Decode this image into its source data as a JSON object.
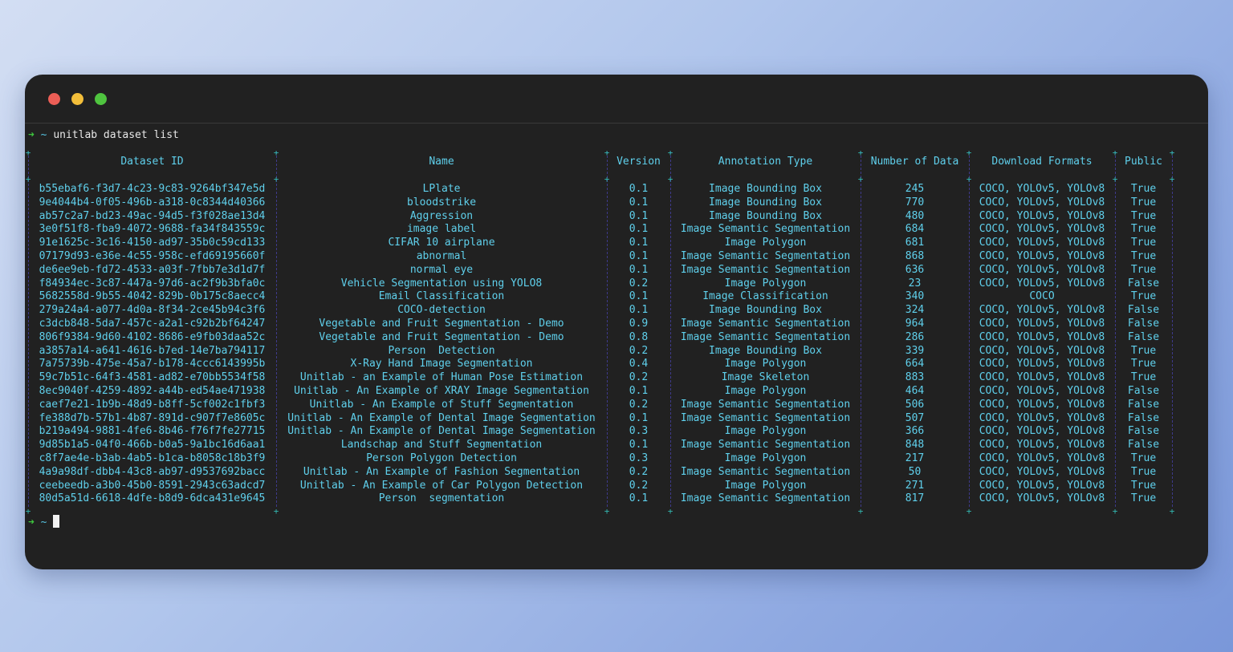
{
  "window": {
    "traffic_lights": [
      "close",
      "minimize",
      "zoom"
    ]
  },
  "prompt": {
    "arrow": "➜",
    "tilde": "~",
    "command": "unitlab dataset list"
  },
  "table": {
    "columns": [
      "Dataset ID",
      "Name",
      "Version",
      "Annotation Type",
      "Number of Data",
      "Download Formats",
      "Public"
    ],
    "rows": [
      [
        "b55ebaf6-f3d7-4c23-9c83-9264bf347e5d",
        "LPlate",
        "0.1",
        "Image Bounding Box",
        "245",
        "COCO, YOLOv5, YOLOv8",
        "True"
      ],
      [
        "9e4044b4-0f05-496b-a318-0c8344d40366",
        "bloodstrike",
        "0.1",
        "Image Bounding Box",
        "770",
        "COCO, YOLOv5, YOLOv8",
        "True"
      ],
      [
        "ab57c2a7-bd23-49ac-94d5-f3f028ae13d4",
        "Aggression",
        "0.1",
        "Image Bounding Box",
        "480",
        "COCO, YOLOv5, YOLOv8",
        "True"
      ],
      [
        "3e0f51f8-fba9-4072-9688-fa34f843559c",
        "image label",
        "0.1",
        "Image Semantic Segmentation",
        "684",
        "COCO, YOLOv5, YOLOv8",
        "True"
      ],
      [
        "91e1625c-3c16-4150-ad97-35b0c59cd133",
        "CIFAR 10 airplane",
        "0.1",
        "Image Polygon",
        "681",
        "COCO, YOLOv5, YOLOv8",
        "True"
      ],
      [
        "07179d93-e36e-4c55-958c-efd69195660f",
        "abnormal",
        "0.1",
        "Image Semantic Segmentation",
        "868",
        "COCO, YOLOv5, YOLOv8",
        "True"
      ],
      [
        "de6ee9eb-fd72-4533-a03f-7fbb7e3d1d7f",
        "normal eye",
        "0.1",
        "Image Semantic Segmentation",
        "636",
        "COCO, YOLOv5, YOLOv8",
        "True"
      ],
      [
        "f84934ec-3c87-447a-97d6-ac2f9b3bfa0c",
        "Vehicle Segmentation using YOLO8",
        "0.2",
        "Image Polygon",
        "23",
        "COCO, YOLOv5, YOLOv8",
        "False"
      ],
      [
        "5682558d-9b55-4042-829b-0b175c8aecc4",
        "Email Classification",
        "0.1",
        "Image Classification",
        "340",
        "COCO",
        "True"
      ],
      [
        "279a24a4-a077-4d0a-8f34-2ce45b94c3f6",
        "COCO-detection",
        "0.1",
        "Image Bounding Box",
        "324",
        "COCO, YOLOv5, YOLOv8",
        "False"
      ],
      [
        "c3dcb848-5da7-457c-a2a1-c92b2bf64247",
        "Vegetable and Fruit Segmentation - Demo",
        "0.9",
        "Image Semantic Segmentation",
        "964",
        "COCO, YOLOv5, YOLOv8",
        "False"
      ],
      [
        "806f9384-9d60-4102-8686-e9fb03daa52c",
        "Vegetable and Fruit Segmentation - Demo",
        "0.8",
        "Image Semantic Segmentation",
        "286",
        "COCO, YOLOv5, YOLOv8",
        "False"
      ],
      [
        "a3857a14-a641-4616-b7ed-14e7ba794117",
        "Person  Detection",
        "0.2",
        "Image Bounding Box",
        "339",
        "COCO, YOLOv5, YOLOv8",
        "True"
      ],
      [
        "7a75739b-475e-45a7-b178-4ccc6143995b",
        "X-Ray Hand Image Segmentation",
        "0.4",
        "Image Polygon",
        "664",
        "COCO, YOLOv5, YOLOv8",
        "True"
      ],
      [
        "59c7b51c-64f3-4581-ad82-e70bb5534f58",
        "Unitlab - an Example of Human Pose Estimation",
        "0.2",
        "Image Skeleton",
        "883",
        "COCO, YOLOv5, YOLOv8",
        "True"
      ],
      [
        "8ec9040f-4259-4892-a44b-ed54ae471938",
        "Unitlab - An Example of XRAY Image Segmentation",
        "0.1",
        "Image Polygon",
        "464",
        "COCO, YOLOv5, YOLOv8",
        "False"
      ],
      [
        "caef7e21-1b9b-48d9-b8ff-5cf002c1fbf3",
        "Unitlab - An Example of Stuff Segmentation",
        "0.2",
        "Image Semantic Segmentation",
        "506",
        "COCO, YOLOv5, YOLOv8",
        "False"
      ],
      [
        "fe388d7b-57b1-4b87-891d-c907f7e8605c",
        "Unitlab - An Example of Dental Image Segmentation",
        "0.1",
        "Image Semantic Segmentation",
        "507",
        "COCO, YOLOv5, YOLOv8",
        "False"
      ],
      [
        "b219a494-9881-4fe6-8b46-f76f7fe27715",
        "Unitlab - An Example of Dental Image Segmentation",
        "0.3",
        "Image Polygon",
        "366",
        "COCO, YOLOv5, YOLOv8",
        "False"
      ],
      [
        "9d85b1a5-04f0-466b-b0a5-9a1bc16d6aa1",
        "Landschap and Stuff Segmentation",
        "0.1",
        "Image Semantic Segmentation",
        "848",
        "COCO, YOLOv5, YOLOv8",
        "False"
      ],
      [
        "c8f7ae4e-b3ab-4ab5-b1ca-b8058c18b3f9",
        "Person Polygon Detection",
        "0.3",
        "Image Polygon",
        "217",
        "COCO, YOLOv5, YOLOv8",
        "True"
      ],
      [
        "4a9a98df-dbb4-43c8-ab97-d9537692bacc",
        "Unitlab - An Example of Fashion Segmentation",
        "0.2",
        "Image Semantic Segmentation",
        "50",
        "COCO, YOLOv5, YOLOv8",
        "True"
      ],
      [
        "ceebeedb-a3b0-45b0-8591-2943c63adcd7",
        "Unitlab - An Example of Car Polygon Detection",
        "0.2",
        "Image Polygon",
        "271",
        "COCO, YOLOv5, YOLOv8",
        "True"
      ],
      [
        "80d5a51d-6618-4dfe-b8d9-6dca431e9645",
        "Person  segmentation",
        "0.1",
        "Image Semantic Segmentation",
        "817",
        "COCO, YOLOv5, YOLOv8",
        "True"
      ]
    ]
  },
  "next_prompt": {
    "arrow": "➜",
    "tilde": "~"
  },
  "colors": {
    "terminal_bg": "#212121",
    "table_text": "#5fd0ec",
    "prompt_arrow": "#3ec63e",
    "border_plus": "#33b7b0"
  }
}
